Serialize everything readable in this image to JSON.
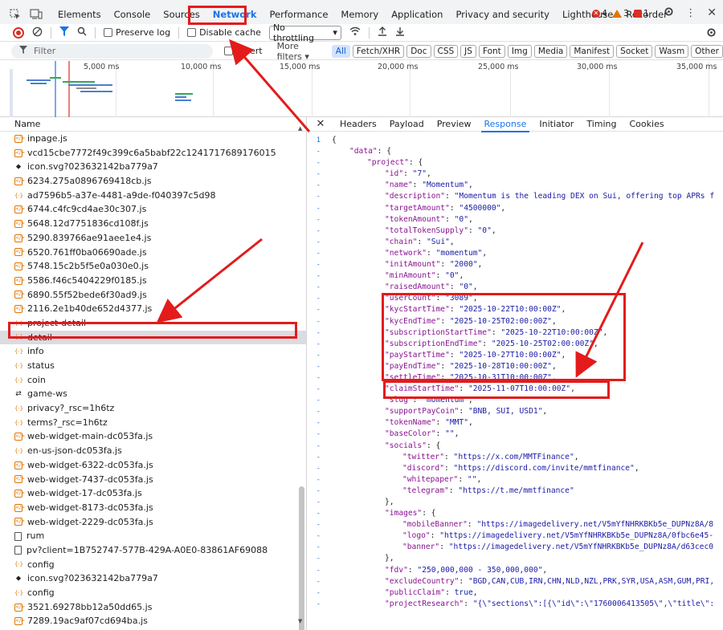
{
  "tabs": [
    "Elements",
    "Console",
    "Sources",
    "Network",
    "Performance",
    "Memory",
    "Application",
    "Privacy and security",
    "Lighthouse",
    "Recorder"
  ],
  "badges": {
    "errors": "4",
    "warnings": "3",
    "info": "1"
  },
  "toolbar": {
    "preserve_log": "Preserve log",
    "disable_cache": "Disable cache",
    "throttling": "No throttling"
  },
  "filter": {
    "placeholder": "Filter",
    "invert": "Invert",
    "more_filters": "More filters"
  },
  "filter_chips": [
    "All",
    "Fetch/XHR",
    "Doc",
    "CSS",
    "JS",
    "Font",
    "Img",
    "Media",
    "Manifest",
    "Socket",
    "Wasm",
    "Other"
  ],
  "overview_ticks": [
    "5,000 ms",
    "10,000 ms",
    "15,000 ms",
    "20,000 ms",
    "25,000 ms",
    "30,000 ms",
    "35,000 ms"
  ],
  "request_list": {
    "header": "Name",
    "rows": [
      {
        "icon": "js",
        "name": "inpage.js"
      },
      {
        "icon": "js",
        "name": "vcd15cbe7772f49c399c6a5babf22c1241717689176015"
      },
      {
        "icon": "img",
        "name": "icon.svg?023632142ba779a7"
      },
      {
        "icon": "js",
        "name": "6234.275a0896769418cb.js"
      },
      {
        "icon": "fetch",
        "name": "ad7596b5-a37e-4481-a9de-f040397c5d98"
      },
      {
        "icon": "js",
        "name": "6744.c4fc9cd4ae30c307.js"
      },
      {
        "icon": "js",
        "name": "5648.12d7751836cd108f.js"
      },
      {
        "icon": "js",
        "name": "5290.839766ae91aee1e4.js"
      },
      {
        "icon": "js",
        "name": "6520.761ff0ba06690ade.js"
      },
      {
        "icon": "js",
        "name": "5748.15c2b5f5e0a030e0.js"
      },
      {
        "icon": "js",
        "name": "5586.f46c5404229f0185.js"
      },
      {
        "icon": "js",
        "name": "6890.55f52bede6f30ad9.js"
      },
      {
        "icon": "js",
        "name": "2116.2e1b40de652d4377.js"
      },
      {
        "icon": "fetch",
        "name": "project-detail"
      },
      {
        "icon": "fetch",
        "name": "detail",
        "selected": true
      },
      {
        "icon": "fetch",
        "name": "info"
      },
      {
        "icon": "fetch",
        "name": "status"
      },
      {
        "icon": "fetch",
        "name": "coin"
      },
      {
        "icon": "ws",
        "name": "game-ws"
      },
      {
        "icon": "fetch",
        "name": "privacy?_rsc=1h6tz"
      },
      {
        "icon": "fetch",
        "name": "terms?_rsc=1h6tz"
      },
      {
        "icon": "js",
        "name": "web-widget-main-dc053fa.js"
      },
      {
        "icon": "fetch",
        "name": "en-us-json-dc053fa.js"
      },
      {
        "icon": "js",
        "name": "web-widget-6322-dc053fa.js"
      },
      {
        "icon": "js",
        "name": "web-widget-7437-dc053fa.js"
      },
      {
        "icon": "js",
        "name": "web-widget-17-dc053fa.js"
      },
      {
        "icon": "js",
        "name": "web-widget-8173-dc053fa.js"
      },
      {
        "icon": "js",
        "name": "web-widget-2229-dc053fa.js"
      },
      {
        "icon": "doc",
        "name": "rum"
      },
      {
        "icon": "doc",
        "name": "pv?client=1B752747-577B-429A-A0E0-83861AF69088"
      },
      {
        "icon": "fetch",
        "name": "config"
      },
      {
        "icon": "img",
        "name": "icon.svg?023632142ba779a7"
      },
      {
        "icon": "fetch",
        "name": "config"
      },
      {
        "icon": "js",
        "name": "3521.69278bb12a50dd65.js"
      },
      {
        "icon": "js",
        "name": "7289.19ac9af07cd694ba.js"
      }
    ]
  },
  "detail_tabs": [
    "Headers",
    "Payload",
    "Preview",
    "Response",
    "Initiator",
    "Timing",
    "Cookies"
  ],
  "response_lines": [
    {
      "n": "1",
      "indent": 0,
      "text": "{"
    },
    {
      "n": "-",
      "indent": 1,
      "key": "\"data\"",
      "rest": ": {"
    },
    {
      "n": "-",
      "indent": 2,
      "key": "\"project\"",
      "rest": ": {"
    },
    {
      "n": "-",
      "indent": 3,
      "key": "\"id\"",
      "val": "\"7\"",
      "tail": ","
    },
    {
      "n": "-",
      "indent": 3,
      "key": "\"name\"",
      "val": "\"Momentum\"",
      "tail": ","
    },
    {
      "n": "-",
      "indent": 3,
      "key": "\"description\"",
      "val": "\"Momentum is the leading DEX on Sui, offering top APRs f",
      "tail": ""
    },
    {
      "n": "-",
      "indent": 3,
      "key": "\"targetAmount\"",
      "val": "\"4500000\"",
      "tail": ","
    },
    {
      "n": "-",
      "indent": 3,
      "key": "\"tokenAmount\"",
      "val": "\"0\"",
      "tail": ","
    },
    {
      "n": "-",
      "indent": 3,
      "key": "\"totalTokenSupply\"",
      "val": "\"0\"",
      "tail": ","
    },
    {
      "n": "-",
      "indent": 3,
      "key": "\"chain\"",
      "val": "\"Sui\"",
      "tail": ","
    },
    {
      "n": "-",
      "indent": 3,
      "key": "\"network\"",
      "val": "\"momentum\"",
      "tail": ","
    },
    {
      "n": "-",
      "indent": 3,
      "key": "\"initAmount\"",
      "val": "\"2000\"",
      "tail": ","
    },
    {
      "n": "-",
      "indent": 3,
      "key": "\"minAmount\"",
      "val": "\"0\"",
      "tail": ","
    },
    {
      "n": "-",
      "indent": 3,
      "key": "\"raisedAmount\"",
      "val": "\"0\"",
      "tail": ","
    },
    {
      "n": "-",
      "indent": 3,
      "key": "\"userCount\"",
      "val": "\"3089\"",
      "tail": ","
    },
    {
      "n": "-",
      "indent": 3,
      "key": "\"kycStartTime\"",
      "val": "\"2025-10-22T10:00:00Z\"",
      "tail": ","
    },
    {
      "n": "-",
      "indent": 3,
      "key": "\"kycEndTime\"",
      "val": "\"2025-10-25T02:00:00Z\"",
      "tail": ","
    },
    {
      "n": "-",
      "indent": 3,
      "key": "\"subscriptionStartTime\"",
      "val": "\"2025-10-22T10:00:00Z\"",
      "tail": ","
    },
    {
      "n": "-",
      "indent": 3,
      "key": "\"subscriptionEndTime\"",
      "val": "\"2025-10-25T02:00:00Z\"",
      "tail": ","
    },
    {
      "n": "-",
      "indent": 3,
      "key": "\"payStartTime\"",
      "val": "\"2025-10-27T10:00:00Z\"",
      "tail": ","
    },
    {
      "n": "-",
      "indent": 3,
      "key": "\"payEndTime\"",
      "val": "\"2025-10-28T10:00:00Z\"",
      "tail": ","
    },
    {
      "n": "-",
      "indent": 3,
      "key": "\"settleTime\"",
      "val": "\"2025-10-31T10:00:00Z\"",
      "tail": ","
    },
    {
      "n": "-",
      "indent": 3,
      "key": "\"claimStartTime\"",
      "val": "\"2025-11-07T10:00:00Z\"",
      "tail": ","
    },
    {
      "n": "-",
      "indent": 3,
      "key": "\"slug\"",
      "val": "\"momentum\"",
      "tail": ","
    },
    {
      "n": "-",
      "indent": 3,
      "key": "\"supportPayCoin\"",
      "val": "\"BNB, SUI, USD1\"",
      "tail": ","
    },
    {
      "n": "-",
      "indent": 3,
      "key": "\"tokenName\"",
      "val": "\"MMT\"",
      "tail": ","
    },
    {
      "n": "-",
      "indent": 3,
      "key": "\"baseColor\"",
      "val": "\"\"",
      "tail": ","
    },
    {
      "n": "-",
      "indent": 3,
      "key": "\"socials\"",
      "rest": ": {"
    },
    {
      "n": "-",
      "indent": 4,
      "key": "\"twitter\"",
      "val": "\"https://x.com/MMTFinance\"",
      "tail": ","
    },
    {
      "n": "-",
      "indent": 4,
      "key": "\"discord\"",
      "val": "\"https://discord.com/invite/mmtfinance\"",
      "tail": ","
    },
    {
      "n": "-",
      "indent": 4,
      "key": "\"whitepaper\"",
      "val": "\"\"",
      "tail": ","
    },
    {
      "n": "-",
      "indent": 4,
      "key": "\"telegram\"",
      "val": "\"https://t.me/mmtfinance\"",
      "tail": ""
    },
    {
      "n": "-",
      "indent": 3,
      "text": "},"
    },
    {
      "n": "-",
      "indent": 3,
      "key": "\"images\"",
      "rest": ": {"
    },
    {
      "n": "-",
      "indent": 4,
      "key": "\"mobileBanner\"",
      "val": "\"https://imagedelivery.net/V5mYfNHRKBKb5e_DUPNz8A/8",
      "tail": ""
    },
    {
      "n": "-",
      "indent": 4,
      "key": "\"logo\"",
      "val": "\"https://imagedelivery.net/V5mYfNHRKBKb5e_DUPNz8A/0fbc6e45-",
      "tail": ""
    },
    {
      "n": "-",
      "indent": 4,
      "key": "\"banner\"",
      "val": "\"https://imagedelivery.net/V5mYfNHRKBKb5e_DUPNz8A/d63cec0",
      "tail": ""
    },
    {
      "n": "-",
      "indent": 3,
      "text": "},"
    },
    {
      "n": "-",
      "indent": 3,
      "key": "\"fdv\"",
      "val": "\"250,000,000 - 350,000,000\"",
      "tail": ","
    },
    {
      "n": "-",
      "indent": 3,
      "key": "\"excludeCountry\"",
      "val": "\"BGD,CAN,CUB,IRN,CHN,NLD,NZL,PRK,SYR,USA,ASM,GUM,PRI,",
      "tail": ""
    },
    {
      "n": "-",
      "indent": 3,
      "key": "\"publicClaim\"",
      "kwval": "true",
      "tail": ","
    },
    {
      "n": "-",
      "indent": 3,
      "key": "\"projectResearch\"",
      "val": "\"{\\\"sections\\\":[{\\\"id\\\":\\\"1760006413505\\\",\\\"title\\\":",
      "tail": ""
    }
  ],
  "colors": {
    "accent": "#1a73e8",
    "annotation": "#e31b1b",
    "selected_row": "#dadce0"
  }
}
